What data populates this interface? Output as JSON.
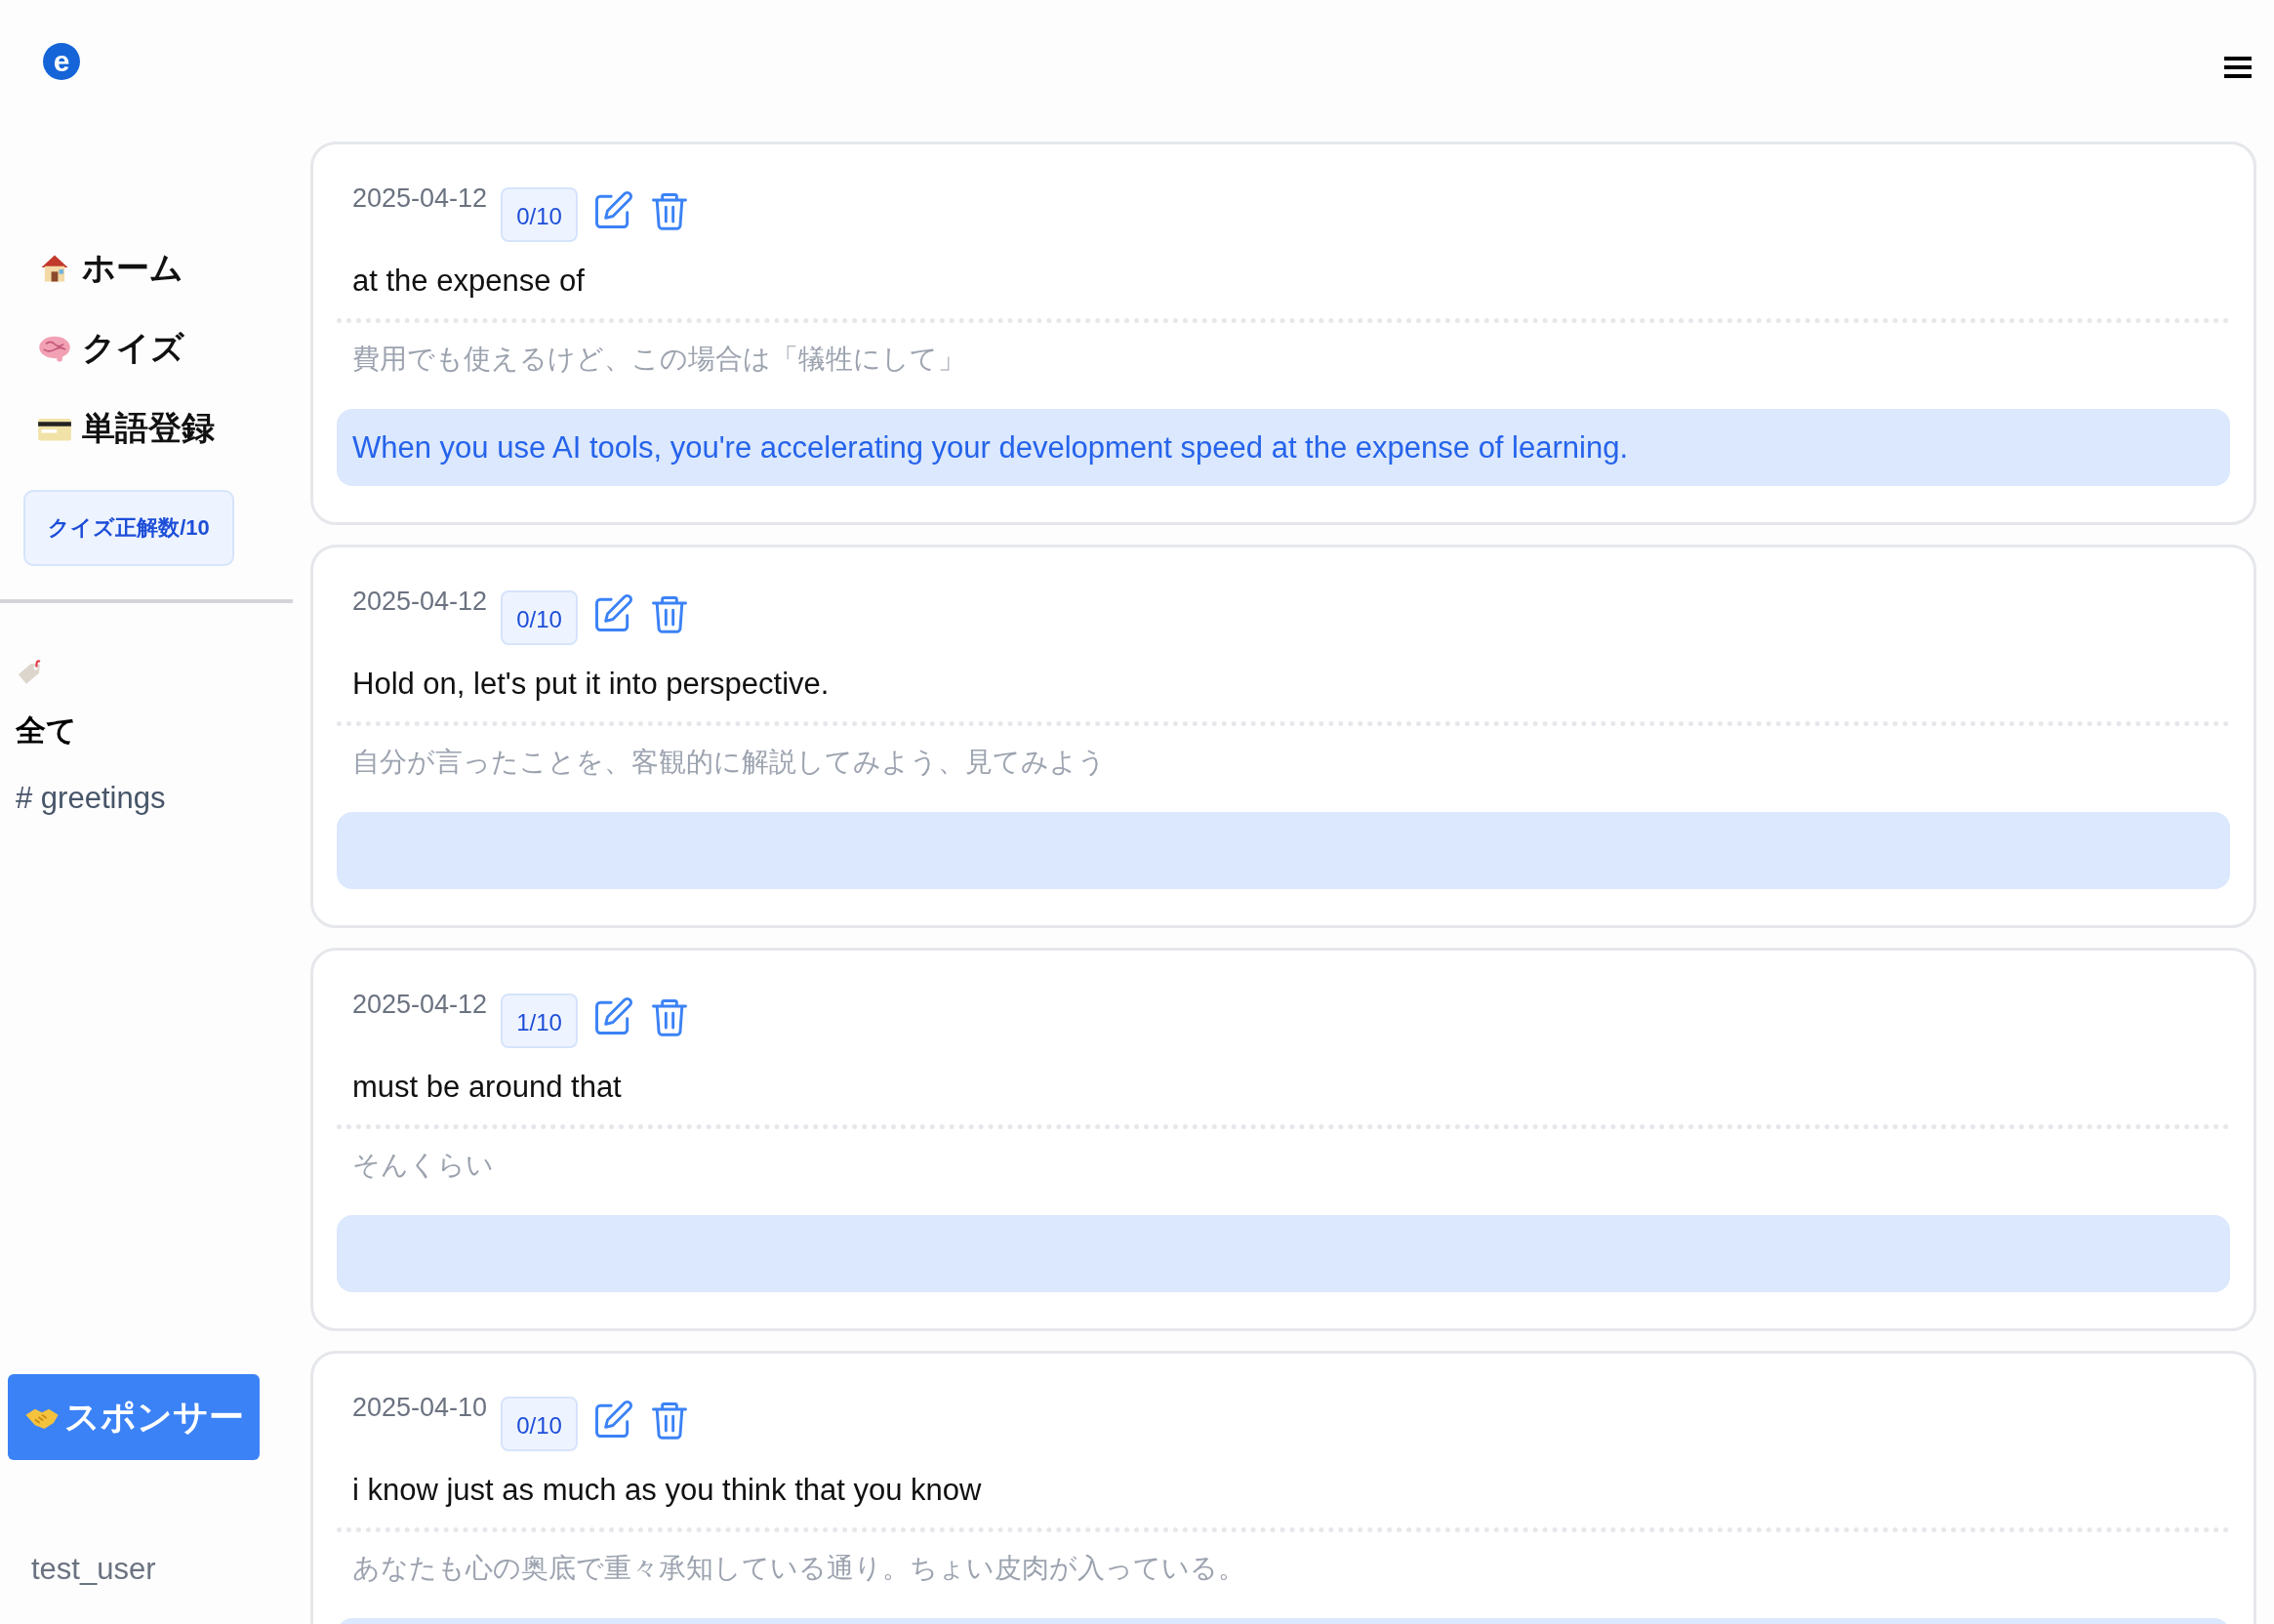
{
  "sidebar": {
    "logo": "e",
    "nav": [
      {
        "kind": "house",
        "label": "ホーム"
      },
      {
        "kind": "brain",
        "label": "クイズ"
      },
      {
        "kind": "card",
        "label": "単語登録"
      }
    ],
    "quiz_badge": "クイズ正解数/10",
    "tags": [
      {
        "label": "全て",
        "selected": true
      },
      {
        "label": "# greetings",
        "selected": false
      }
    ],
    "sponsor_button": "スポンサー",
    "user": "test_user"
  },
  "cards": [
    {
      "date": "2025-04-12",
      "score": "0/10",
      "word": "at the expense of",
      "meaning": "費用でも使えるけど、この場合は「犠牲にして」",
      "example": "When you use AI tools, you're accelerating your development speed at the expense of learning."
    },
    {
      "date": "2025-04-12",
      "score": "0/10",
      "word": "Hold on, let's put it into perspective.",
      "meaning": "自分が言ったことを、客観的に解説してみよう、見てみよう"
    },
    {
      "date": "2025-04-12",
      "score": "1/10",
      "word": "must be around that",
      "meaning": "そんくらい"
    },
    {
      "date": "2025-04-10",
      "score": "0/10",
      "word": "i know just as much as you think that you know",
      "meaning": "あなたも心の奥底で重々承知している通り。ちょい皮肉が入っている。"
    }
  ]
}
